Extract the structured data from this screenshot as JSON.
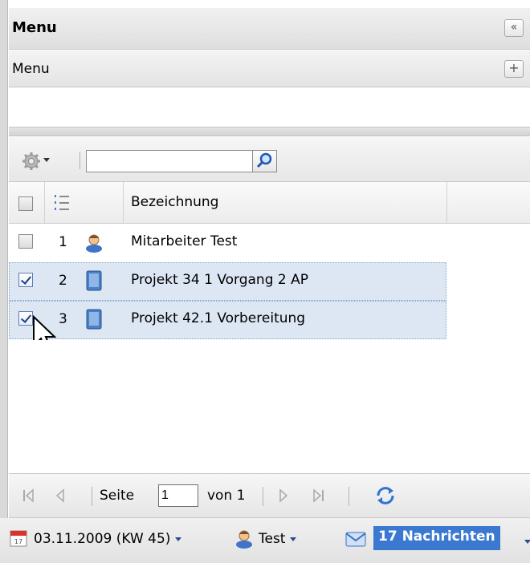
{
  "panel": {
    "title": "Menu",
    "collapse_glyph": "«",
    "section_title": "Menu",
    "add_glyph": "+"
  },
  "toolbar": {
    "settings_icon": "gear-icon",
    "search_placeholder": "",
    "search_icon": "magnifier-icon"
  },
  "grid": {
    "columns": [
      "",
      "",
      "",
      "Bezeichnung"
    ],
    "rows": [
      {
        "num": "1",
        "icon": "person-icon",
        "label": "Mitarbeiter Test",
        "checked": false,
        "selected": false
      },
      {
        "num": "2",
        "icon": "project-book-icon",
        "label": "Projekt 34 1 Vorgang 2 AP",
        "checked": true,
        "selected": true
      },
      {
        "num": "3",
        "icon": "project-book-icon",
        "label": "Projekt 42.1 Vorbereitung",
        "checked": true,
        "selected": true
      }
    ]
  },
  "pager": {
    "page_label": "Seite",
    "page_value": "1",
    "of_label": "von 1"
  },
  "status": {
    "date": "03.11.2009 (KW 45)",
    "user": "Test",
    "messages": "17 Nachrichten"
  },
  "colors": {
    "selection": "#dde7f4",
    "accent": "#3b79d1"
  }
}
